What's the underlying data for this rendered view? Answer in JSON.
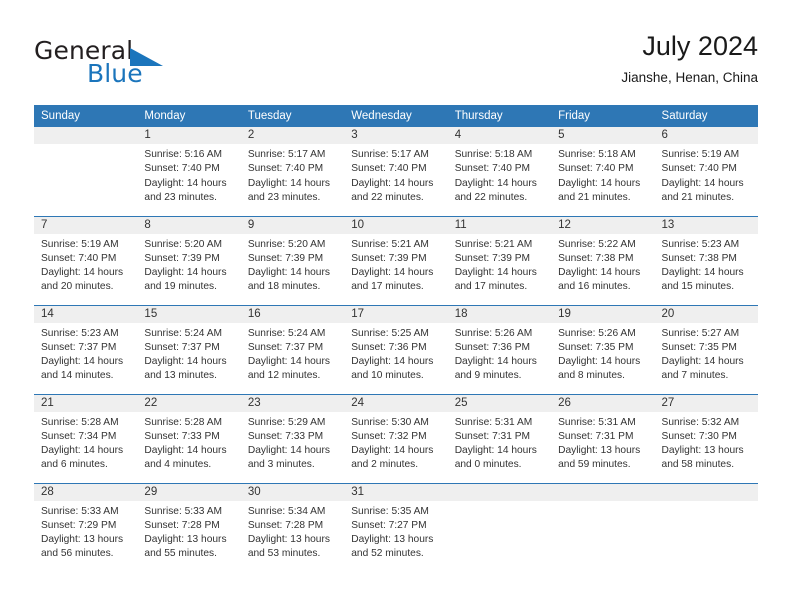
{
  "brand": {
    "name_part1": "General",
    "name_part2": "Blue",
    "triangle_icon": "triangle-icon"
  },
  "header": {
    "title": "July 2024",
    "location": "Jianshe, Henan, China"
  },
  "colors": {
    "header_blue": "#2e77b5",
    "brand_blue": "#1b75bc",
    "daynum_band": "#efefef",
    "text": "#333333"
  },
  "weekday_headers": [
    "Sunday",
    "Monday",
    "Tuesday",
    "Wednesday",
    "Thursday",
    "Friday",
    "Saturday"
  ],
  "weeks": [
    [
      {
        "day": "",
        "sunrise": "",
        "sunset": "",
        "daylight1": "",
        "daylight2": "",
        "empty": true
      },
      {
        "day": "1",
        "sunrise": "Sunrise: 5:16 AM",
        "sunset": "Sunset: 7:40 PM",
        "daylight1": "Daylight: 14 hours",
        "daylight2": "and 23 minutes."
      },
      {
        "day": "2",
        "sunrise": "Sunrise: 5:17 AM",
        "sunset": "Sunset: 7:40 PM",
        "daylight1": "Daylight: 14 hours",
        "daylight2": "and 23 minutes."
      },
      {
        "day": "3",
        "sunrise": "Sunrise: 5:17 AM",
        "sunset": "Sunset: 7:40 PM",
        "daylight1": "Daylight: 14 hours",
        "daylight2": "and 22 minutes."
      },
      {
        "day": "4",
        "sunrise": "Sunrise: 5:18 AM",
        "sunset": "Sunset: 7:40 PM",
        "daylight1": "Daylight: 14 hours",
        "daylight2": "and 22 minutes."
      },
      {
        "day": "5",
        "sunrise": "Sunrise: 5:18 AM",
        "sunset": "Sunset: 7:40 PM",
        "daylight1": "Daylight: 14 hours",
        "daylight2": "and 21 minutes."
      },
      {
        "day": "6",
        "sunrise": "Sunrise: 5:19 AM",
        "sunset": "Sunset: 7:40 PM",
        "daylight1": "Daylight: 14 hours",
        "daylight2": "and 21 minutes."
      }
    ],
    [
      {
        "day": "7",
        "sunrise": "Sunrise: 5:19 AM",
        "sunset": "Sunset: 7:40 PM",
        "daylight1": "Daylight: 14 hours",
        "daylight2": "and 20 minutes."
      },
      {
        "day": "8",
        "sunrise": "Sunrise: 5:20 AM",
        "sunset": "Sunset: 7:39 PM",
        "daylight1": "Daylight: 14 hours",
        "daylight2": "and 19 minutes."
      },
      {
        "day": "9",
        "sunrise": "Sunrise: 5:20 AM",
        "sunset": "Sunset: 7:39 PM",
        "daylight1": "Daylight: 14 hours",
        "daylight2": "and 18 minutes."
      },
      {
        "day": "10",
        "sunrise": "Sunrise: 5:21 AM",
        "sunset": "Sunset: 7:39 PM",
        "daylight1": "Daylight: 14 hours",
        "daylight2": "and 17 minutes."
      },
      {
        "day": "11",
        "sunrise": "Sunrise: 5:21 AM",
        "sunset": "Sunset: 7:39 PM",
        "daylight1": "Daylight: 14 hours",
        "daylight2": "and 17 minutes."
      },
      {
        "day": "12",
        "sunrise": "Sunrise: 5:22 AM",
        "sunset": "Sunset: 7:38 PM",
        "daylight1": "Daylight: 14 hours",
        "daylight2": "and 16 minutes."
      },
      {
        "day": "13",
        "sunrise": "Sunrise: 5:23 AM",
        "sunset": "Sunset: 7:38 PM",
        "daylight1": "Daylight: 14 hours",
        "daylight2": "and 15 minutes."
      }
    ],
    [
      {
        "day": "14",
        "sunrise": "Sunrise: 5:23 AM",
        "sunset": "Sunset: 7:37 PM",
        "daylight1": "Daylight: 14 hours",
        "daylight2": "and 14 minutes."
      },
      {
        "day": "15",
        "sunrise": "Sunrise: 5:24 AM",
        "sunset": "Sunset: 7:37 PM",
        "daylight1": "Daylight: 14 hours",
        "daylight2": "and 13 minutes."
      },
      {
        "day": "16",
        "sunrise": "Sunrise: 5:24 AM",
        "sunset": "Sunset: 7:37 PM",
        "daylight1": "Daylight: 14 hours",
        "daylight2": "and 12 minutes."
      },
      {
        "day": "17",
        "sunrise": "Sunrise: 5:25 AM",
        "sunset": "Sunset: 7:36 PM",
        "daylight1": "Daylight: 14 hours",
        "daylight2": "and 10 minutes."
      },
      {
        "day": "18",
        "sunrise": "Sunrise: 5:26 AM",
        "sunset": "Sunset: 7:36 PM",
        "daylight1": "Daylight: 14 hours",
        "daylight2": "and 9 minutes."
      },
      {
        "day": "19",
        "sunrise": "Sunrise: 5:26 AM",
        "sunset": "Sunset: 7:35 PM",
        "daylight1": "Daylight: 14 hours",
        "daylight2": "and 8 minutes."
      },
      {
        "day": "20",
        "sunrise": "Sunrise: 5:27 AM",
        "sunset": "Sunset: 7:35 PM",
        "daylight1": "Daylight: 14 hours",
        "daylight2": "and 7 minutes."
      }
    ],
    [
      {
        "day": "21",
        "sunrise": "Sunrise: 5:28 AM",
        "sunset": "Sunset: 7:34 PM",
        "daylight1": "Daylight: 14 hours",
        "daylight2": "and 6 minutes."
      },
      {
        "day": "22",
        "sunrise": "Sunrise: 5:28 AM",
        "sunset": "Sunset: 7:33 PM",
        "daylight1": "Daylight: 14 hours",
        "daylight2": "and 4 minutes."
      },
      {
        "day": "23",
        "sunrise": "Sunrise: 5:29 AM",
        "sunset": "Sunset: 7:33 PM",
        "daylight1": "Daylight: 14 hours",
        "daylight2": "and 3 minutes."
      },
      {
        "day": "24",
        "sunrise": "Sunrise: 5:30 AM",
        "sunset": "Sunset: 7:32 PM",
        "daylight1": "Daylight: 14 hours",
        "daylight2": "and 2 minutes."
      },
      {
        "day": "25",
        "sunrise": "Sunrise: 5:31 AM",
        "sunset": "Sunset: 7:31 PM",
        "daylight1": "Daylight: 14 hours",
        "daylight2": "and 0 minutes."
      },
      {
        "day": "26",
        "sunrise": "Sunrise: 5:31 AM",
        "sunset": "Sunset: 7:31 PM",
        "daylight1": "Daylight: 13 hours",
        "daylight2": "and 59 minutes."
      },
      {
        "day": "27",
        "sunrise": "Sunrise: 5:32 AM",
        "sunset": "Sunset: 7:30 PM",
        "daylight1": "Daylight: 13 hours",
        "daylight2": "and 58 minutes."
      }
    ],
    [
      {
        "day": "28",
        "sunrise": "Sunrise: 5:33 AM",
        "sunset": "Sunset: 7:29 PM",
        "daylight1": "Daylight: 13 hours",
        "daylight2": "and 56 minutes."
      },
      {
        "day": "29",
        "sunrise": "Sunrise: 5:33 AM",
        "sunset": "Sunset: 7:28 PM",
        "daylight1": "Daylight: 13 hours",
        "daylight2": "and 55 minutes."
      },
      {
        "day": "30",
        "sunrise": "Sunrise: 5:34 AM",
        "sunset": "Sunset: 7:28 PM",
        "daylight1": "Daylight: 13 hours",
        "daylight2": "and 53 minutes."
      },
      {
        "day": "31",
        "sunrise": "Sunrise: 5:35 AM",
        "sunset": "Sunset: 7:27 PM",
        "daylight1": "Daylight: 13 hours",
        "daylight2": "and 52 minutes."
      },
      {
        "day": "",
        "sunrise": "",
        "sunset": "",
        "daylight1": "",
        "daylight2": "",
        "empty": true
      },
      {
        "day": "",
        "sunrise": "",
        "sunset": "",
        "daylight1": "",
        "daylight2": "",
        "empty": true
      },
      {
        "day": "",
        "sunrise": "",
        "sunset": "",
        "daylight1": "",
        "daylight2": "",
        "empty": true
      }
    ]
  ]
}
